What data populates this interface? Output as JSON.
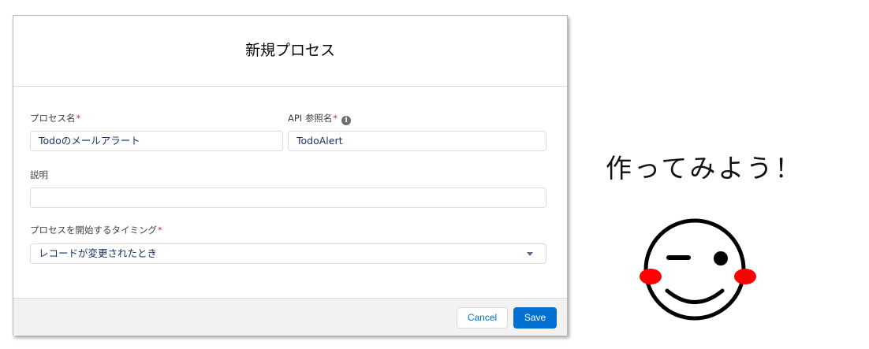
{
  "modal": {
    "title": "新規プロセス",
    "process_name": {
      "label": "プロセス名",
      "required_mark": "*",
      "value": "Todoのメールアラート"
    },
    "api_name": {
      "label": "API 参照名",
      "required_mark": "*",
      "value": "TodoAlert",
      "info_icon": "i"
    },
    "description": {
      "label": "説明",
      "value": ""
    },
    "trigger": {
      "label": "プロセスを開始するタイミング",
      "required_mark": "*",
      "selected": "レコードが変更されたとき"
    },
    "footer": {
      "cancel_label": "Cancel",
      "save_label": "Save"
    }
  },
  "annotation": {
    "text": "作ってみよう！"
  },
  "colors": {
    "brand_blue": "#0070d2",
    "required_red": "#c23934",
    "cheek_red": "#ff0000"
  }
}
